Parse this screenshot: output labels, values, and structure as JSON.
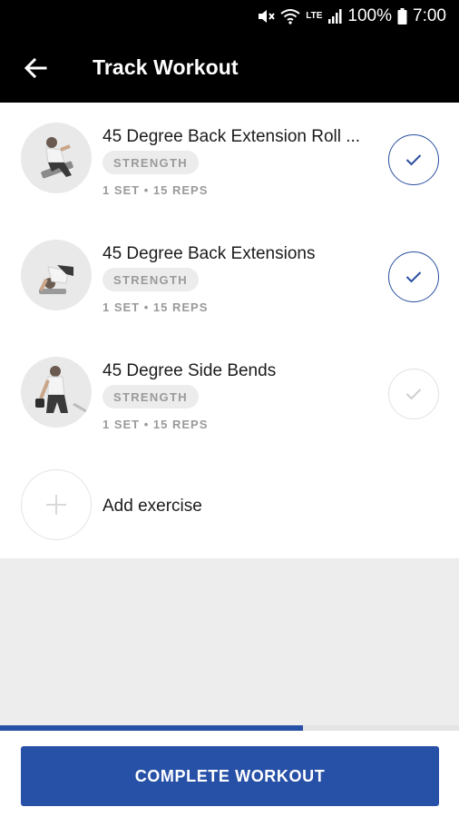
{
  "status_bar": {
    "battery": "100%",
    "time": "7:00",
    "network": "LTE",
    "icons": [
      "mute-icon",
      "wifi-icon",
      "lte-icon",
      "signal-icon",
      "battery-icon"
    ]
  },
  "app_bar": {
    "title": "Track Workout",
    "back_icon": "arrow-left-icon"
  },
  "exercises": [
    {
      "name": "45 Degree Back Extension Roll ...",
      "category": "STRENGTH",
      "sets_reps": "1 SET • 15 REPS",
      "completed": true
    },
    {
      "name": "45 Degree Back Extensions",
      "category": "STRENGTH",
      "sets_reps": "1 SET • 15 REPS",
      "completed": true
    },
    {
      "name": "45 Degree Side Bends",
      "category": "STRENGTH",
      "sets_reps": "1 SET • 15 REPS",
      "completed": false
    }
  ],
  "add_exercise": {
    "label": "Add exercise",
    "icon": "plus-icon"
  },
  "progress": {
    "fraction": 0.66
  },
  "footer": {
    "complete_label": "COMPLETE WORKOUT"
  },
  "colors": {
    "accent": "#2750a7",
    "bar": "#000000",
    "grey": "#ededed"
  }
}
